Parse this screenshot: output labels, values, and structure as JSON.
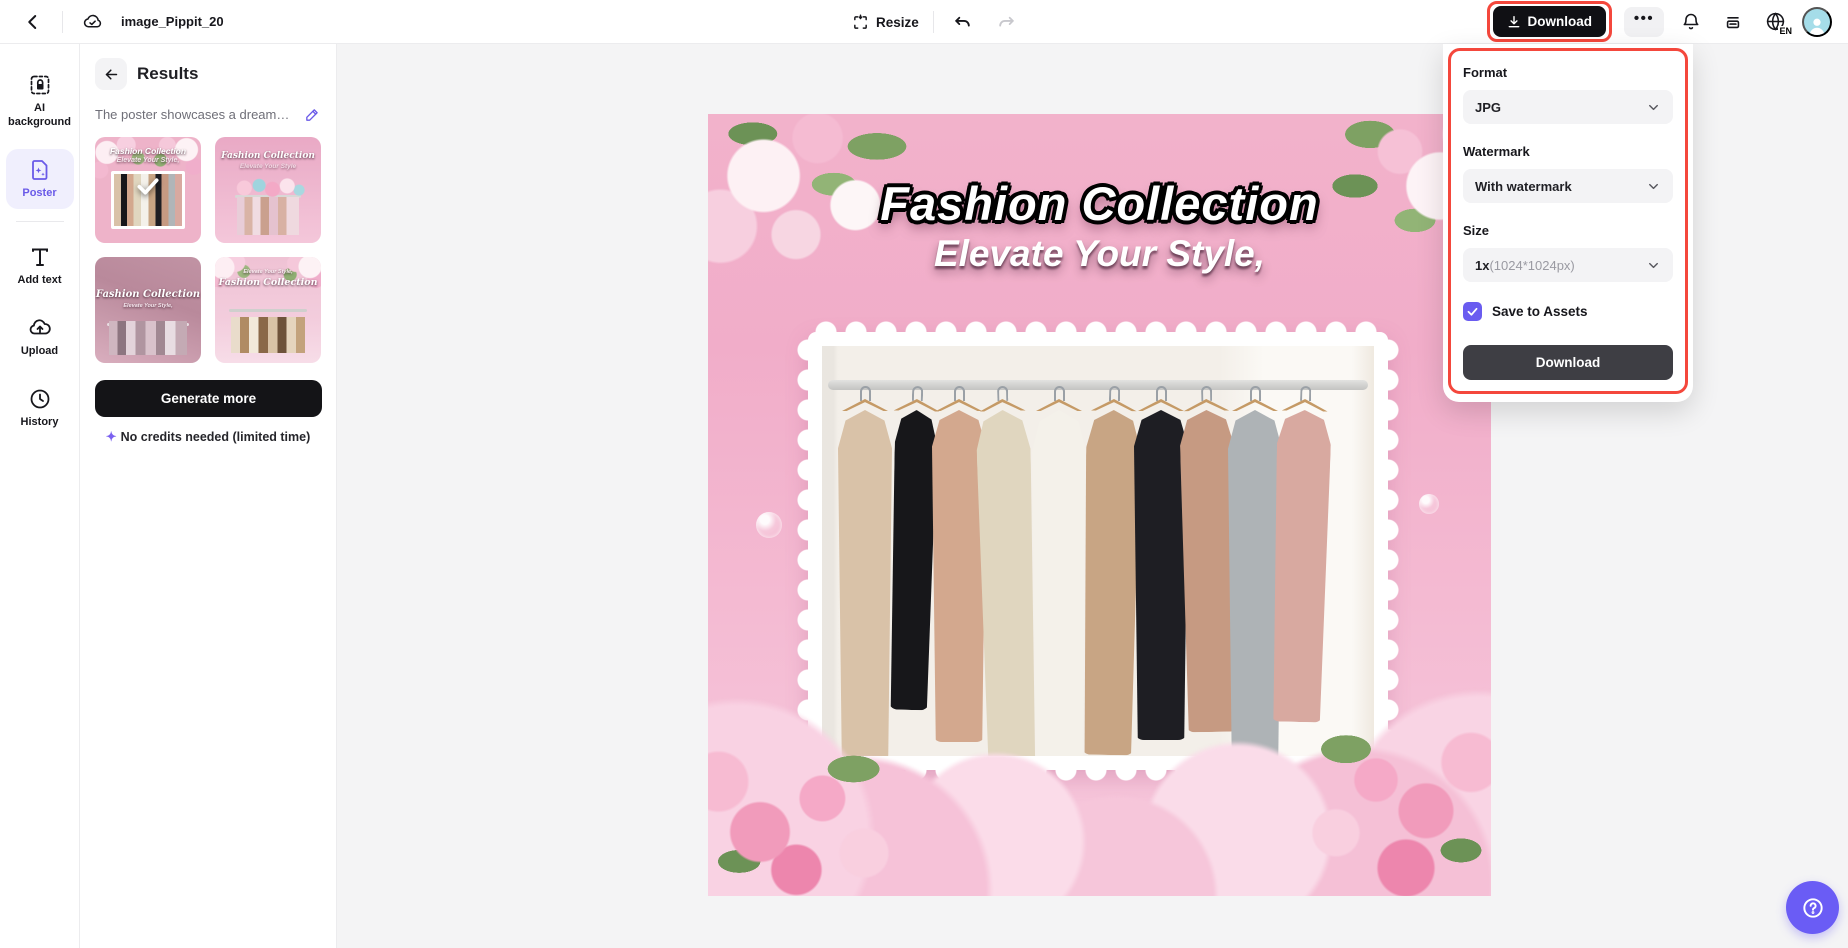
{
  "topbar": {
    "filename": "image_Pippit_20",
    "resize_label": "Resize",
    "download_label": "Download",
    "language": "EN",
    "more_dots": "•••"
  },
  "sidebar": {
    "items": [
      {
        "label": "AI background",
        "active": false
      },
      {
        "label": "Poster",
        "active": true
      },
      {
        "label": "Add text",
        "active": false
      },
      {
        "label": "Upload",
        "active": false
      },
      {
        "label": "History",
        "active": false
      }
    ]
  },
  "results_panel": {
    "title": "Results",
    "description": "The poster showcases a dreamy…",
    "generate_button": "Generate more",
    "credits_note": "No credits needed (limited time)"
  },
  "poster": {
    "title": "Fashion Collection",
    "subtitle": "Elevate Your Style,"
  },
  "thumbnails": [
    {
      "title": "Fashion Collection",
      "subtitle": "Elevate Your Style,",
      "selected": true
    },
    {
      "title": "Fashion Collection",
      "subtitle": "Elevate Your Style",
      "selected": false
    },
    {
      "title": "Fashion Collection",
      "subtitle": "Elevate Your Style,",
      "selected": false
    },
    {
      "title": "Fashion Collection",
      "subtitle": "Elevate Your Style,",
      "selected": false
    }
  ],
  "download_panel": {
    "format_label": "Format",
    "format_value": "JPG",
    "watermark_label": "Watermark",
    "watermark_value": "With watermark",
    "size_label": "Size",
    "size_value": "1x",
    "size_detail": "(1024*1024px)",
    "save_to_assets_label": "Save to Assets",
    "save_to_assets_checked": true,
    "download_button": "Download"
  },
  "colors": {
    "accent_purple": "#6a5ae8",
    "annotation_red": "#f4473c",
    "topbar_button_black": "#101014",
    "panel_button_charcoal": "#3e3e44",
    "avatar_teal": "#a5dde9"
  }
}
